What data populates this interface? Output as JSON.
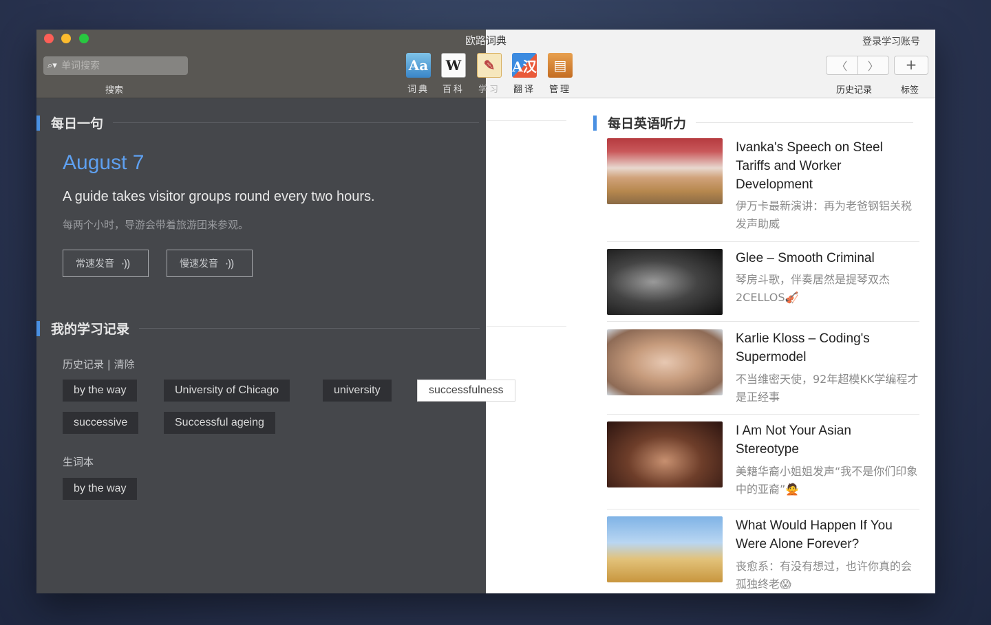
{
  "window": {
    "title_left": "欧路",
    "title_right": "词典",
    "login": "登录学习账号"
  },
  "toolbar": {
    "search_placeholder": "单词搜索",
    "search_label": "搜索",
    "tools": [
      {
        "label": "词典",
        "icon": "dictionary-icon",
        "glyph": "Aa"
      },
      {
        "label": "百科",
        "icon": "wikipedia-icon",
        "glyph": "W"
      },
      {
        "label": "学习",
        "icon": "study-notebook-icon",
        "glyph": "✎"
      },
      {
        "label": "翻译",
        "icon": "translate-icon",
        "glyph": "A汉"
      },
      {
        "label": "管理",
        "icon": "manage-cabinet-icon",
        "glyph": "▤"
      }
    ],
    "history_label": "历史记录",
    "bookmark_label": "标签"
  },
  "daily_sentence": {
    "heading": "每日一句",
    "date": "August 7",
    "sentence": "A guide takes visitor groups round every two hours.",
    "translation": "每两个小时，导游会带着旅游团来参观。",
    "normal_speed": "常速发音",
    "slow_speed": "慢速发音"
  },
  "study_record": {
    "heading": "我的学习记录",
    "history_label": "历史记录",
    "separator": "|",
    "clear_label": "清除",
    "history_items": [
      "by the way",
      "University of Chicago",
      "university",
      "successfulness",
      "successive",
      "Successful ageing"
    ],
    "vocab_label": "生词本",
    "vocab_items": [
      "by the way"
    ]
  },
  "listening": {
    "heading": "每日英语听力",
    "articles": [
      {
        "title": "Ivanka's Speech on Steel Tariffs and Worker Development",
        "desc": "伊万卡最新演讲：再为老爸钢铝关税发声助威"
      },
      {
        "title": "Glee – Smooth Criminal",
        "desc": "琴房斗歌，伴奏居然是提琴双杰2CELLOS🎻"
      },
      {
        "title": "Karlie Kloss – Coding's Supermodel",
        "desc": "不当维密天使，92年超模KK学编程才是正经事"
      },
      {
        "title": "I Am Not Your Asian Stereotype",
        "desc": "美籍华裔小姐姐发声“我不是你们印象中的亚裔”🙅"
      },
      {
        "title": "What Would Happen If You Were Alone Forever?",
        "desc": "丧愈系：有没有想过，也许你真的会孤独终老😱"
      }
    ]
  }
}
